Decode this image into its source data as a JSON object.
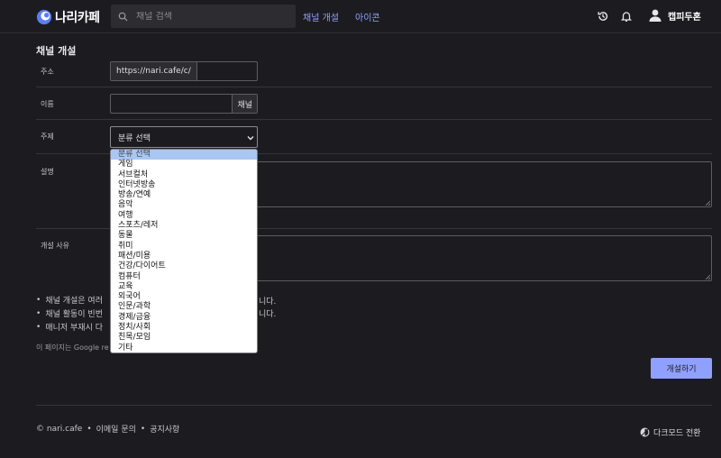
{
  "header": {
    "logo_text": "나리카페",
    "search_placeholder": "채널 검색",
    "nav": [
      "채널 개설",
      "아이콘"
    ],
    "username": "캡피두혼"
  },
  "form": {
    "title": "채널 개설",
    "labels": {
      "address": "주소",
      "name": "이름",
      "topic": "주제",
      "description": "설명",
      "reason": "개설 사유"
    },
    "address_prefix": "https://nari.cafe/c/",
    "address_value": "",
    "name_value": "",
    "name_suffix": "채널",
    "topic_selected": "분류 선택",
    "topic_options": [
      "분류 선택",
      "게임",
      "서브컬처",
      "인터넷방송",
      "방송/연예",
      "음악",
      "여행",
      "스포츠/레저",
      "동물",
      "취미",
      "패션/미용",
      "건강/다이어트",
      "컴퓨터",
      "교육",
      "외국어",
      "인문/과학",
      "경제/금융",
      "정치/사회",
      "친목/모임",
      "기타"
    ],
    "notes": [
      "채널 개설은 여러",
      "채널 활동이 빈번",
      "매니저 부재시 다"
    ],
    "notes_tail": [
      "니다.",
      "니다.",
      ""
    ],
    "recaptcha": "이 페이지는 Google re",
    "submit_label": "개설하기"
  },
  "footer": {
    "copyright": "© nari.cafe",
    "links": [
      "이메일 문의",
      "공지사항"
    ],
    "dark_mode": "다크모드 전환"
  },
  "colors": {
    "background": "#1c1c20",
    "accent": "#8fa0ff",
    "selected_option": "#a9c7f2"
  }
}
